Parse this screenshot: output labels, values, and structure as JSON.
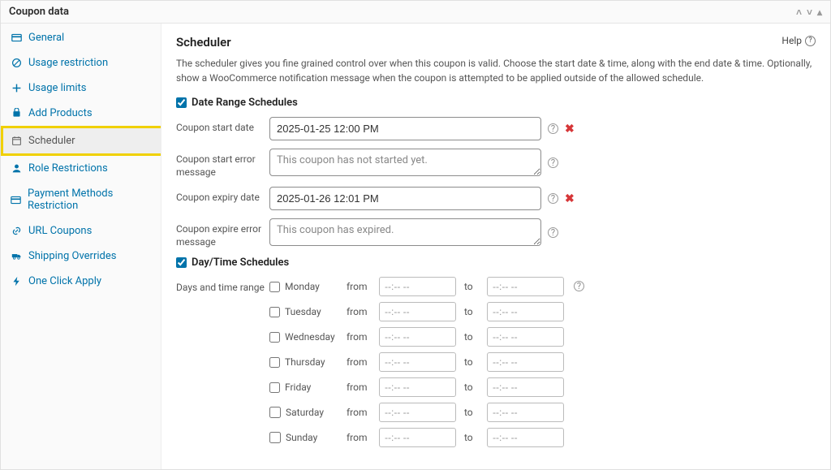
{
  "panel": {
    "title": "Coupon data"
  },
  "help_label": "Help",
  "sidebar": {
    "items": [
      {
        "label": "General"
      },
      {
        "label": "Usage restriction"
      },
      {
        "label": "Usage limits"
      },
      {
        "label": "Add Products"
      },
      {
        "label": "Scheduler"
      },
      {
        "label": "Role Restrictions"
      },
      {
        "label": "Payment Methods Restriction"
      },
      {
        "label": "URL Coupons"
      },
      {
        "label": "Shipping Overrides"
      },
      {
        "label": "One Click Apply"
      }
    ]
  },
  "main": {
    "title": "Scheduler",
    "intro": "The scheduler gives you fine grained control over when this coupon is valid. Choose the start date & time, along with the end date & time. Optionally, show a WooCommerce notification message when the coupon is attempted to be applied outside of the allowed schedule.",
    "date_range_heading": "Date Range Schedules",
    "start_label": "Coupon start date",
    "start_value": "2025-01-25 12:00 PM",
    "start_error_label": "Coupon start error message",
    "start_error_placeholder": "This coupon has not started yet.",
    "expiry_label": "Coupon expiry date",
    "expiry_value": "2025-01-26 12:01 PM",
    "expire_error_label": "Coupon expire error message",
    "expire_error_placeholder": "This coupon has expired.",
    "daytime_heading": "Day/Time Schedules",
    "days_range_label": "Days and time range",
    "from_label": "from",
    "to_label": "to",
    "time_placeholder": "--:-- --",
    "days": [
      {
        "label": "Monday"
      },
      {
        "label": "Tuesday"
      },
      {
        "label": "Wednesday"
      },
      {
        "label": "Thursday"
      },
      {
        "label": "Friday"
      },
      {
        "label": "Saturday"
      },
      {
        "label": "Sunday"
      }
    ]
  }
}
